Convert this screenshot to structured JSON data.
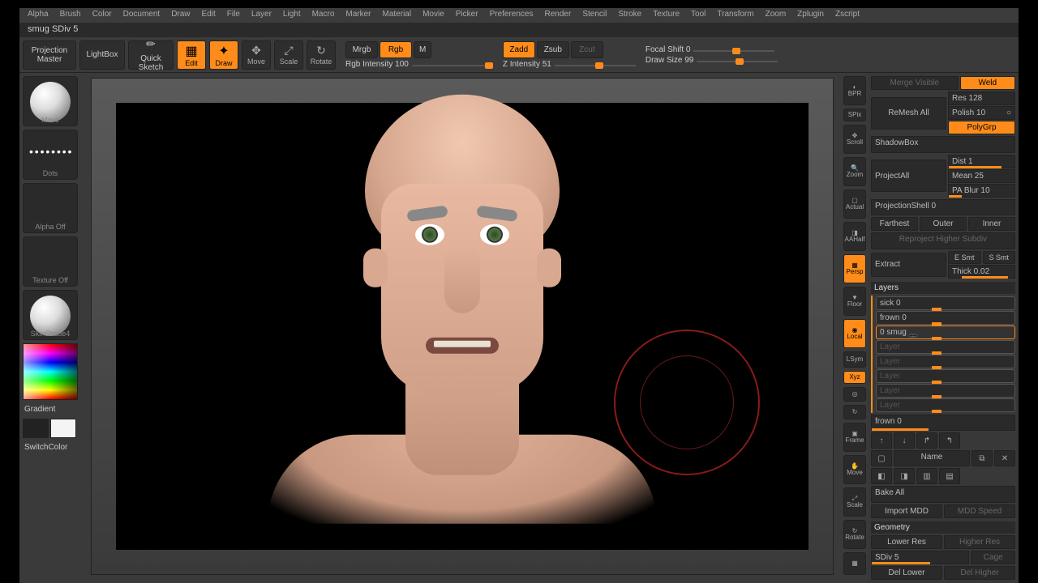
{
  "menus": [
    "Alpha",
    "Brush",
    "Color",
    "Document",
    "Draw",
    "Edit",
    "File",
    "Layer",
    "Light",
    "Macro",
    "Marker",
    "Material",
    "Movie",
    "Picker",
    "Preferences",
    "Render",
    "Stencil",
    "Stroke",
    "Texture",
    "Tool",
    "Transform",
    "Zoom",
    "Zplugin",
    "Zscript"
  ],
  "title": "smug SDiv 5",
  "toolbar": {
    "projection_master": "Projection Master",
    "lightbox": "LightBox",
    "quick_sketch": "Quick Sketch",
    "edit": "Edit",
    "draw": "Draw",
    "move": "Move",
    "scale": "Scale",
    "rotate": "Rotate",
    "mrgb": "Mrgb",
    "rgb": "Rgb",
    "m": "M",
    "rgb_intensity_label": "Rgb Intensity 100",
    "zadd": "Zadd",
    "zsub": "Zsub",
    "zcut": "Zcut",
    "z_intensity_label": "Z Intensity 51",
    "focal_shift_label": "Focal Shift 0",
    "draw_size_label": "Draw Size 99"
  },
  "left": {
    "move": "Move",
    "dots": "Dots",
    "alpha_off": "Alpha Off",
    "texture_off": "Texture Off",
    "skinshade4": "SkinShade4",
    "gradient": "Gradient",
    "switchcolor": "SwitchColor"
  },
  "right_icons": {
    "bpr": "BPR",
    "spix": "SPix",
    "scroll": "Scroll",
    "zoom": "Zoom",
    "actual": "Actual",
    "aahalf": "AAHalf",
    "persp": "Persp",
    "floor": "Floor",
    "local": "Local",
    "lsym": "LSym",
    "xyz": "Xyz",
    "frame": "Frame",
    "move": "Move",
    "scale": "Scale",
    "rotate": "Rotate",
    "polyf": "PolyF"
  },
  "right": {
    "merge_visible": "Merge Visible",
    "weld": "Weld",
    "remesh_all": "ReMesh All",
    "res": "Res 128",
    "polish": "Polish 10",
    "polygrp": "PolyGrp",
    "shadowbox": "ShadowBox",
    "projectall": "ProjectAll",
    "dist": "Dist 1",
    "mean": "Mean 25",
    "pa_blur": "PA Blur 10",
    "projectionshell": "ProjectionShell 0",
    "farthest": "Farthest",
    "outer": "Outer",
    "inner": "Inner",
    "reproject": "Reproject Higher Subdiv",
    "extract": "Extract",
    "e_smt": "E Smt",
    "s_smt": "S Smt",
    "thick": "Thick 0.02",
    "layers_header": "Layers",
    "layers": [
      {
        "name": "sick 0"
      },
      {
        "name": "frown 0"
      },
      {
        "name": "0 smug"
      }
    ],
    "empty_layers": [
      "Layer",
      "Layer",
      "Layer",
      "Layer",
      "Layer"
    ],
    "current_layer": "frown 0",
    "name_btn": "Name",
    "bake_all": "Bake All",
    "import_mdd": "Import MDD",
    "mdd_speed": "MDD Speed",
    "geometry_header": "Geometry",
    "lower_res": "Lower Res",
    "higher_res": "Higher Res",
    "sdiv": "SDiv 5",
    "cage": "Cage",
    "del_lower": "Del Lower",
    "del_higher": "Del Higher"
  }
}
